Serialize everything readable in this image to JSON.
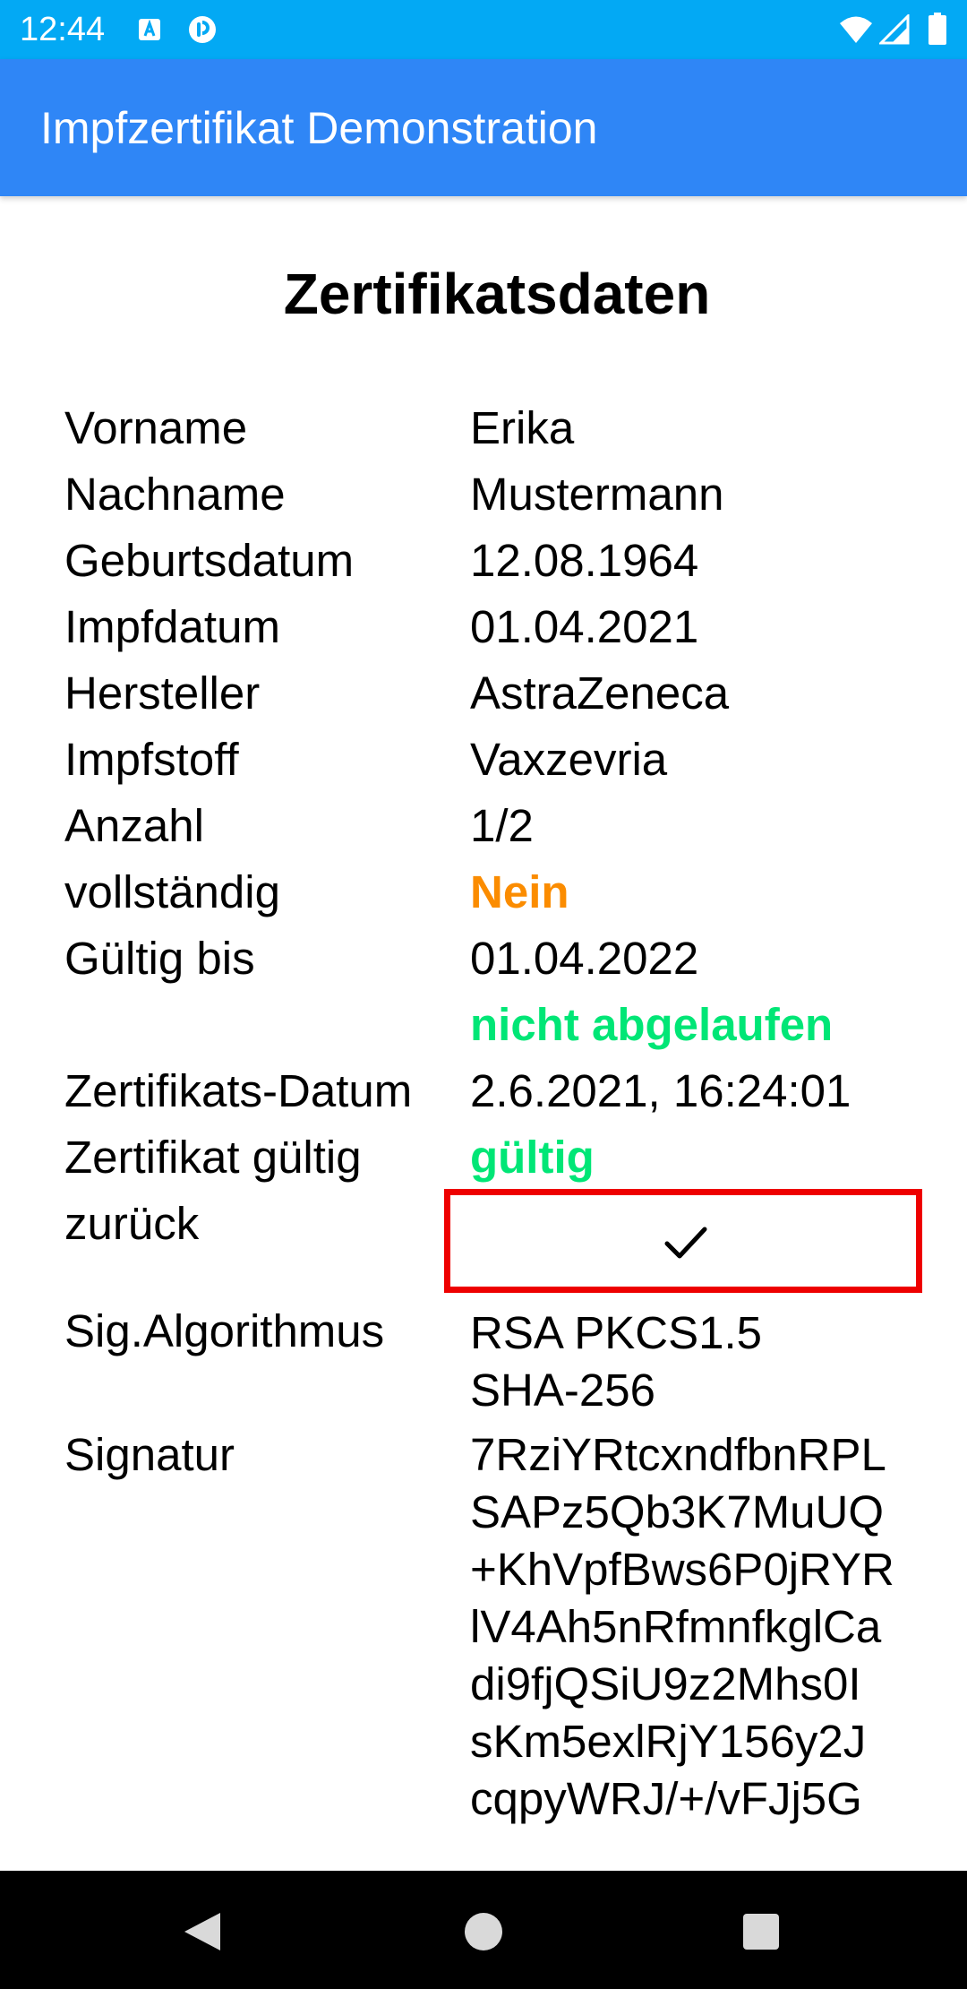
{
  "status_bar": {
    "time": "12:44",
    "icons": [
      "a-notification-icon",
      "p-notification-icon",
      "wifi-icon",
      "signal-icon",
      "battery-icon"
    ]
  },
  "app_bar": {
    "title": "Impfzertifikat Demonstration"
  },
  "heading": "Zertifikatsdaten",
  "rows": {
    "vorname": {
      "label": "Vorname",
      "value": "Erika"
    },
    "nachname": {
      "label": "Nachname",
      "value": "Mustermann"
    },
    "geburtsdatum": {
      "label": "Geburtsdatum",
      "value": "12.08.1964"
    },
    "impfdatum": {
      "label": "Impfdatum",
      "value": "01.04.2021"
    },
    "hersteller": {
      "label": "Hersteller",
      "value": "AstraZeneca"
    },
    "impfstoff": {
      "label": "Impfstoff",
      "value": "Vaxzevria"
    },
    "anzahl": {
      "label": "Anzahl",
      "value": "1/2"
    },
    "vollstaendig": {
      "label": "vollständig",
      "value": "Nein"
    },
    "gueltig_bis": {
      "label": "Gültig bis",
      "value": "01.04.2022",
      "status": "nicht abgelaufen"
    },
    "zertifikats_datum": {
      "label": "Zertifikats-Datum",
      "value": "2.6.2021, 16:24:01"
    },
    "zertifikat_gueltig": {
      "label": "Zertifikat gültig",
      "value": "gültig"
    },
    "zurueck": {
      "label": "zurück",
      "checked": true
    },
    "sig_algorithmus": {
      "label": "Sig.Algorithmus",
      "lines": [
        "RSA PKCS1.5",
        "SHA-256"
      ]
    },
    "signatur": {
      "label": "Signatur",
      "lines": [
        "7RziYRtcxndfbnRPL",
        "SAPz5Qb3K7MuUQ",
        "+KhVpfBws6P0jRYR",
        "lV4Ah5nRfmnfkglCa",
        "di9fjQSiU9z2Mhs0I",
        "sKm5exlRjY156y2J",
        "cqpyWRJ/+/vFJj5G"
      ]
    }
  },
  "colors": {
    "status_bar": "#03A9F4",
    "app_bar": "#2F86F6",
    "warning": "#FB8C00",
    "ok": "#00E676",
    "highlight_border": "#EE0000"
  },
  "nav_bar": {
    "icons": [
      "back-icon",
      "home-icon",
      "recents-icon"
    ]
  }
}
